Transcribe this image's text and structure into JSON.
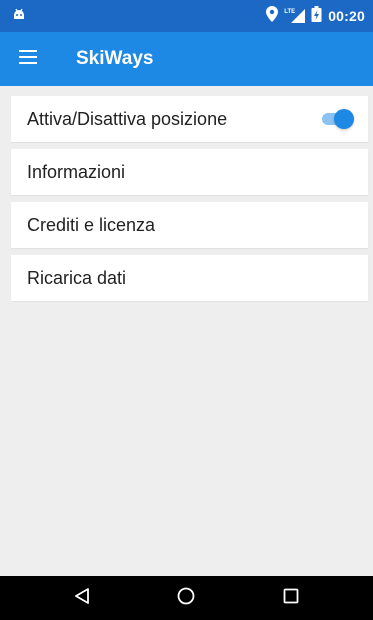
{
  "status_bar": {
    "time": "00:20",
    "network_label": "LTE",
    "icons": [
      "android-icon",
      "location-icon",
      "signal-icon",
      "battery-icon"
    ]
  },
  "app_bar": {
    "title": "SkiWays",
    "menu_icon": "hamburger-menu-icon"
  },
  "settings": {
    "items": [
      {
        "label": "Attiva/Disattiva posizione",
        "toggle_on": true
      },
      {
        "label": "Informazioni"
      },
      {
        "label": "Crediti e licenza"
      },
      {
        "label": "Ricarica dati"
      }
    ]
  },
  "navigation": {
    "icons": [
      "back-icon",
      "home-icon",
      "recents-icon"
    ]
  },
  "colors": {
    "status_bar": "#1c68c5",
    "app_bar": "#1e88e5",
    "background": "#eeeeee",
    "toggle_track": "#8cc2f1",
    "toggle_knob": "#1e88e5"
  }
}
